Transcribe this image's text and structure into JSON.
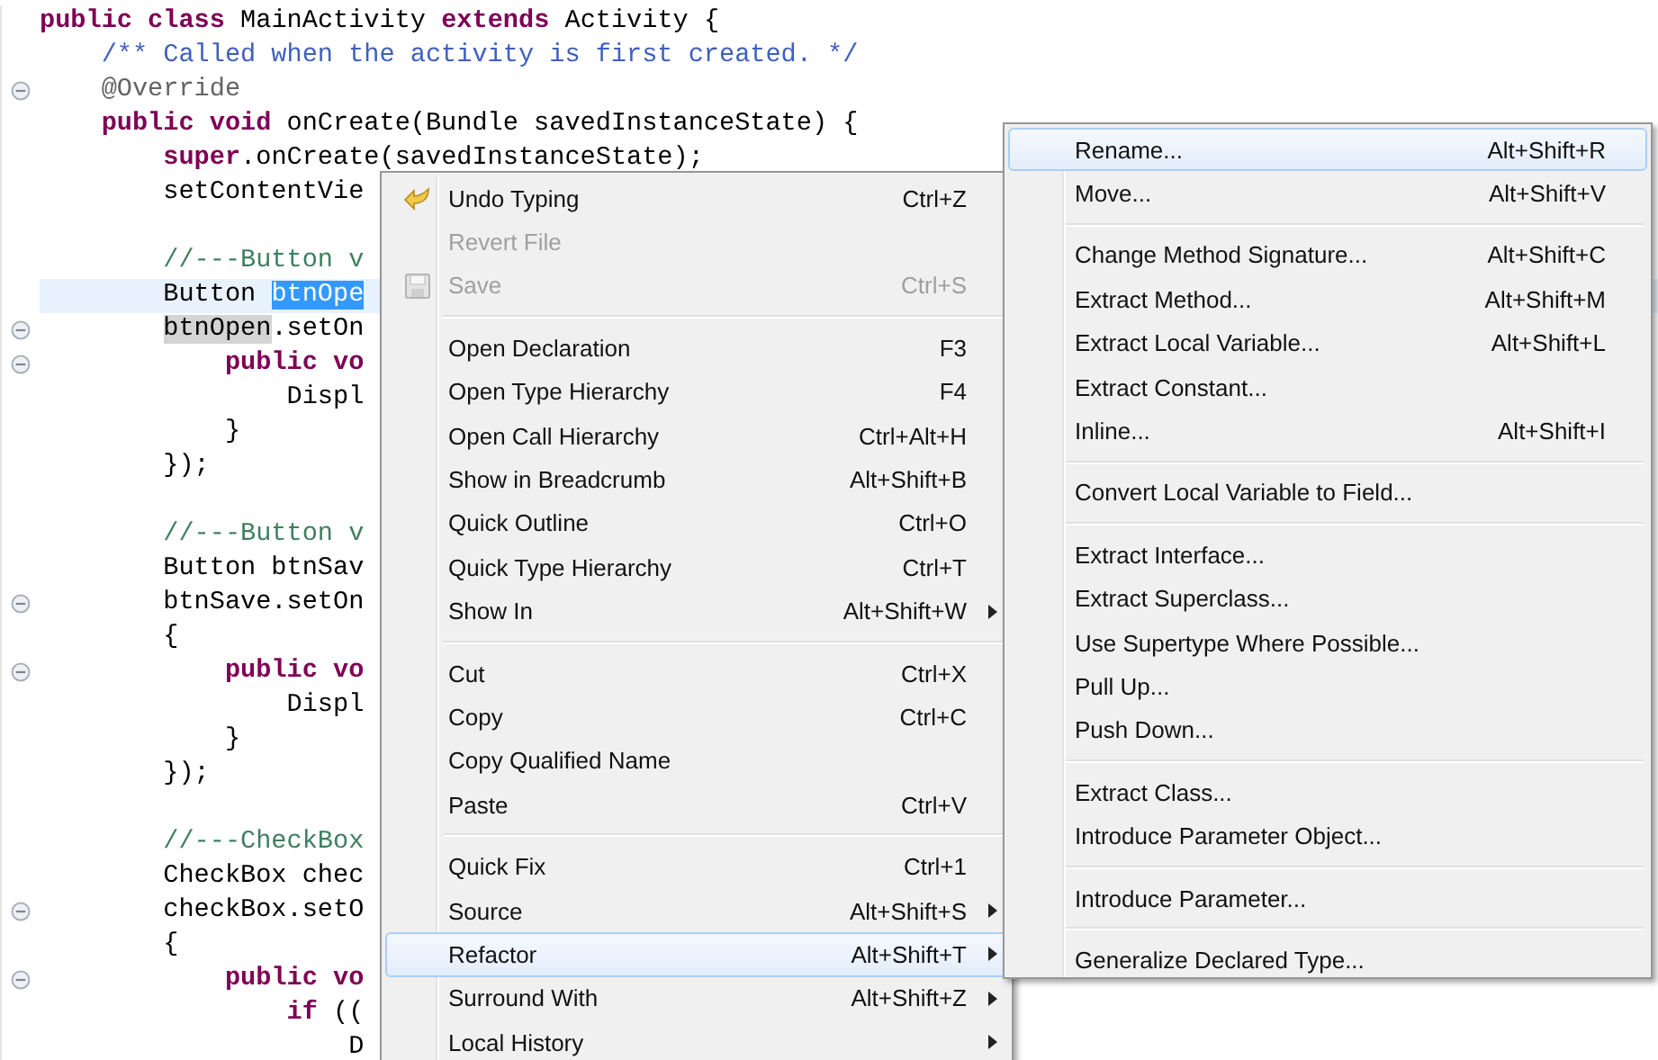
{
  "editor": {
    "lines": [
      {
        "kind": "code",
        "fold": false,
        "current": false,
        "segments": [
          {
            "text": "public class",
            "kind": "keyword"
          },
          {
            "text": " MainActivity ",
            "kind": "plain"
          },
          {
            "text": "extends",
            "kind": "keyword"
          },
          {
            "text": " Activity {",
            "kind": "plain"
          }
        ]
      },
      {
        "kind": "code",
        "fold": false,
        "current": false,
        "segments": [
          {
            "text": "    /** Called when the activity is first created. */",
            "kind": "javadoc"
          }
        ]
      },
      {
        "kind": "code",
        "fold": true,
        "current": false,
        "segments": [
          {
            "text": "    @Override",
            "kind": "annotation"
          }
        ]
      },
      {
        "kind": "code",
        "fold": false,
        "current": false,
        "segments": [
          {
            "text": "    public void",
            "kind": "keyword"
          },
          {
            "text": " onCreate(Bundle savedInstanceState) {",
            "kind": "plain"
          }
        ]
      },
      {
        "kind": "code",
        "fold": false,
        "current": false,
        "segments": [
          {
            "text": "        super",
            "kind": "keyword"
          },
          {
            "text": ".onCreate(savedInstanceState);",
            "kind": "plain"
          }
        ]
      },
      {
        "kind": "code",
        "fold": false,
        "current": false,
        "segments": [
          {
            "text": "        setContentVie",
            "kind": "plain"
          }
        ]
      },
      {
        "kind": "blank"
      },
      {
        "kind": "code",
        "fold": false,
        "current": false,
        "segments": [
          {
            "text": "        //---Button v",
            "kind": "comment"
          }
        ]
      },
      {
        "kind": "code",
        "fold": false,
        "current": true,
        "segments": [
          {
            "text": "        Button ",
            "kind": "plain"
          },
          {
            "text": "btnOpe",
            "kind": "selection"
          }
        ]
      },
      {
        "kind": "code",
        "fold": true,
        "current": false,
        "segments": [
          {
            "text": "        btnOpen",
            "kind": "occurrence"
          },
          {
            "text": ".setOn",
            "kind": "plain"
          }
        ]
      },
      {
        "kind": "code",
        "fold": true,
        "current": false,
        "segments": [
          {
            "text": "            public vo",
            "kind": "keyword"
          }
        ]
      },
      {
        "kind": "code",
        "fold": false,
        "current": false,
        "segments": [
          {
            "text": "                Displ",
            "kind": "plain"
          }
        ]
      },
      {
        "kind": "code",
        "fold": false,
        "current": false,
        "segments": [
          {
            "text": "            }",
            "kind": "plain"
          }
        ]
      },
      {
        "kind": "code",
        "fold": false,
        "current": false,
        "segments": [
          {
            "text": "        });",
            "kind": "plain"
          }
        ]
      },
      {
        "kind": "blank"
      },
      {
        "kind": "code",
        "fold": false,
        "current": false,
        "segments": [
          {
            "text": "        //---Button v",
            "kind": "comment"
          }
        ]
      },
      {
        "kind": "code",
        "fold": false,
        "current": false,
        "segments": [
          {
            "text": "        Button btnSav",
            "kind": "plain"
          }
        ]
      },
      {
        "kind": "code",
        "fold": true,
        "current": false,
        "segments": [
          {
            "text": "        btnSave.setOn",
            "kind": "plain"
          }
        ]
      },
      {
        "kind": "code",
        "fold": false,
        "current": false,
        "segments": [
          {
            "text": "        {",
            "kind": "plain"
          }
        ]
      },
      {
        "kind": "code",
        "fold": true,
        "current": false,
        "segments": [
          {
            "text": "            public vo",
            "kind": "keyword"
          }
        ]
      },
      {
        "kind": "code",
        "fold": false,
        "current": false,
        "segments": [
          {
            "text": "                Displ",
            "kind": "plain"
          }
        ]
      },
      {
        "kind": "code",
        "fold": false,
        "current": false,
        "segments": [
          {
            "text": "            }",
            "kind": "plain"
          }
        ]
      },
      {
        "kind": "code",
        "fold": false,
        "current": false,
        "segments": [
          {
            "text": "        });",
            "kind": "plain"
          }
        ]
      },
      {
        "kind": "blank"
      },
      {
        "kind": "code",
        "fold": false,
        "current": false,
        "segments": [
          {
            "text": "        //---CheckBox",
            "kind": "comment"
          }
        ]
      },
      {
        "kind": "code",
        "fold": false,
        "current": false,
        "segments": [
          {
            "text": "        CheckBox chec",
            "kind": "plain"
          }
        ]
      },
      {
        "kind": "code",
        "fold": true,
        "current": false,
        "segments": [
          {
            "text": "        checkBox.setO",
            "kind": "plain"
          }
        ]
      },
      {
        "kind": "code",
        "fold": false,
        "current": false,
        "segments": [
          {
            "text": "        {",
            "kind": "plain"
          }
        ]
      },
      {
        "kind": "code",
        "fold": true,
        "current": false,
        "segments": [
          {
            "text": "            public vo",
            "kind": "keyword"
          }
        ]
      },
      {
        "kind": "code",
        "fold": false,
        "current": false,
        "segments": [
          {
            "text": "                if",
            "kind": "keyword"
          },
          {
            "text": " ((",
            "kind": "plain"
          }
        ]
      },
      {
        "kind": "code",
        "fold": false,
        "current": false,
        "segments": [
          {
            "text": "                    D",
            "kind": "plain"
          }
        ]
      }
    ]
  },
  "context_menu": {
    "items": [
      {
        "kind": "item",
        "label": "Undo Typing",
        "shortcut": "Ctrl+Z",
        "disabled": false,
        "submenu": false,
        "selected": false
      },
      {
        "kind": "item",
        "label": "Revert File",
        "disabled": true,
        "submenu": false,
        "selected": false
      },
      {
        "kind": "item",
        "label": "Save",
        "shortcut": "Ctrl+S",
        "disabled": true,
        "submenu": false,
        "selected": false
      },
      {
        "kind": "separator"
      },
      {
        "kind": "item",
        "label": "Open Declaration",
        "shortcut": "F3",
        "disabled": false,
        "submenu": false,
        "selected": false
      },
      {
        "kind": "item",
        "label": "Open Type Hierarchy",
        "shortcut": "F4",
        "disabled": false,
        "submenu": false,
        "selected": false
      },
      {
        "kind": "item",
        "label": "Open Call Hierarchy",
        "shortcut": "Ctrl+Alt+H",
        "disabled": false,
        "submenu": false,
        "selected": false
      },
      {
        "kind": "item",
        "label": "Show in Breadcrumb",
        "shortcut": "Alt+Shift+B",
        "disabled": false,
        "submenu": false,
        "selected": false
      },
      {
        "kind": "item",
        "label": "Quick Outline",
        "shortcut": "Ctrl+O",
        "disabled": false,
        "submenu": false,
        "selected": false
      },
      {
        "kind": "item",
        "label": "Quick Type Hierarchy",
        "shortcut": "Ctrl+T",
        "disabled": false,
        "submenu": false,
        "selected": false
      },
      {
        "kind": "item",
        "label": "Show In",
        "shortcut": "Alt+Shift+W",
        "disabled": false,
        "submenu": true,
        "selected": false
      },
      {
        "kind": "separator"
      },
      {
        "kind": "item",
        "label": "Cut",
        "shortcut": "Ctrl+X",
        "disabled": false,
        "submenu": false,
        "selected": false
      },
      {
        "kind": "item",
        "label": "Copy",
        "shortcut": "Ctrl+C",
        "disabled": false,
        "submenu": false,
        "selected": false
      },
      {
        "kind": "item",
        "label": "Copy Qualified Name",
        "disabled": false,
        "submenu": false,
        "selected": false
      },
      {
        "kind": "item",
        "label": "Paste",
        "shortcut": "Ctrl+V",
        "disabled": false,
        "submenu": false,
        "selected": false
      },
      {
        "kind": "separator"
      },
      {
        "kind": "item",
        "label": "Quick Fix",
        "shortcut": "Ctrl+1",
        "disabled": false,
        "submenu": false,
        "selected": false
      },
      {
        "kind": "item",
        "label": "Source",
        "shortcut": "Alt+Shift+S",
        "disabled": false,
        "submenu": true,
        "selected": false
      },
      {
        "kind": "item",
        "label": "Refactor",
        "shortcut": "Alt+Shift+T",
        "disabled": false,
        "submenu": true,
        "selected": true
      },
      {
        "kind": "item",
        "label": "Surround With",
        "shortcut": "Alt+Shift+Z",
        "disabled": false,
        "submenu": true,
        "selected": false
      },
      {
        "kind": "item",
        "label": "Local History",
        "disabled": false,
        "submenu": true,
        "selected": false
      }
    ]
  },
  "refactor_submenu": {
    "items": [
      {
        "kind": "item",
        "label": "Rename...",
        "shortcut": "Alt+Shift+R",
        "disabled": false,
        "submenu": false,
        "selected": true
      },
      {
        "kind": "item",
        "label": "Move...",
        "shortcut": "Alt+Shift+V",
        "disabled": false,
        "submenu": false,
        "selected": false
      },
      {
        "kind": "separator"
      },
      {
        "kind": "item",
        "label": "Change Method Signature...",
        "shortcut": "Alt+Shift+C",
        "disabled": false,
        "submenu": false,
        "selected": false
      },
      {
        "kind": "item",
        "label": "Extract Method...",
        "shortcut": "Alt+Shift+M",
        "disabled": false,
        "submenu": false,
        "selected": false
      },
      {
        "kind": "item",
        "label": "Extract Local Variable...",
        "shortcut": "Alt+Shift+L",
        "disabled": false,
        "submenu": false,
        "selected": false
      },
      {
        "kind": "item",
        "label": "Extract Constant...",
        "disabled": false,
        "submenu": false,
        "selected": false
      },
      {
        "kind": "item",
        "label": "Inline...",
        "shortcut": "Alt+Shift+I",
        "disabled": false,
        "submenu": false,
        "selected": false
      },
      {
        "kind": "separator"
      },
      {
        "kind": "item",
        "label": "Convert Local Variable to Field...",
        "disabled": false,
        "submenu": false,
        "selected": false
      },
      {
        "kind": "separator"
      },
      {
        "kind": "item",
        "label": "Extract Interface...",
        "disabled": false,
        "submenu": false,
        "selected": false
      },
      {
        "kind": "item",
        "label": "Extract Superclass...",
        "disabled": false,
        "submenu": false,
        "selected": false
      },
      {
        "kind": "item",
        "label": "Use Supertype Where Possible...",
        "disabled": false,
        "submenu": false,
        "selected": false
      },
      {
        "kind": "item",
        "label": "Pull Up...",
        "disabled": false,
        "submenu": false,
        "selected": false
      },
      {
        "kind": "item",
        "label": "Push Down...",
        "disabled": false,
        "submenu": false,
        "selected": false
      },
      {
        "kind": "separator"
      },
      {
        "kind": "item",
        "label": "Extract Class...",
        "disabled": false,
        "submenu": false,
        "selected": false
      },
      {
        "kind": "item",
        "label": "Introduce Parameter Object...",
        "disabled": false,
        "submenu": false,
        "selected": false
      },
      {
        "kind": "separator"
      },
      {
        "kind": "item",
        "label": "Introduce Parameter...",
        "disabled": false,
        "submenu": false,
        "selected": false
      },
      {
        "kind": "separator"
      },
      {
        "kind": "item",
        "label": "Generalize Declared Type...",
        "disabled": false,
        "submenu": false,
        "selected": false
      }
    ]
  }
}
